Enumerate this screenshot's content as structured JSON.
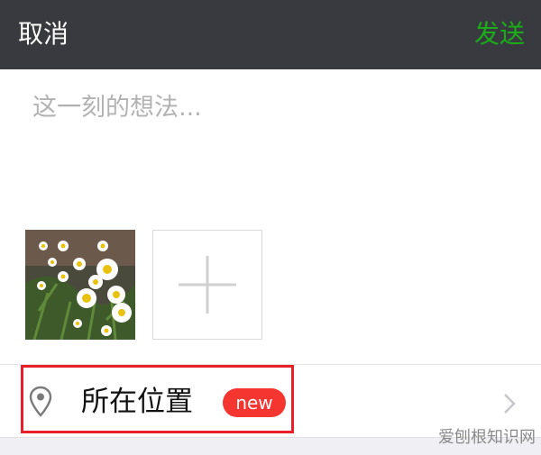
{
  "header": {
    "cancel_label": "取消",
    "send_label": "发送",
    "background": "#393a3f",
    "send_color": "#1aad19"
  },
  "composer": {
    "placeholder": "这一刻的想法...",
    "value": ""
  },
  "media": {
    "attachments": [
      {
        "icon": "daisy-flowers-photo"
      }
    ],
    "add_button_icon": "plus-icon"
  },
  "location": {
    "label": "所在位置",
    "badge": "new",
    "badge_color": "#f43530",
    "icon": "location-pin-icon",
    "chevron": "chevron-right-icon",
    "highlight_color": "#e8202a"
  },
  "watermark": "爱刨根知识网"
}
